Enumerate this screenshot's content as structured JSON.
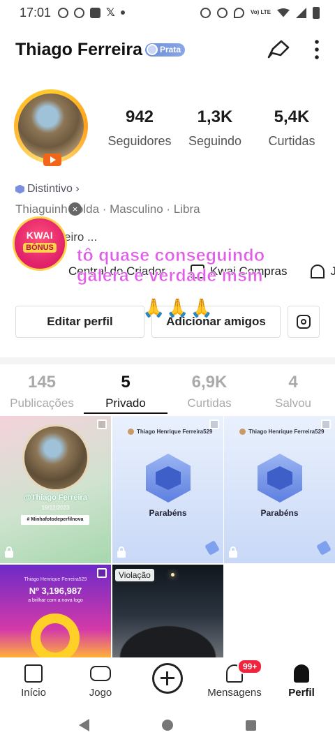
{
  "status_bar": {
    "time": "17:01",
    "network": "Vo) LTE"
  },
  "profile": {
    "name": "Thiago Ferreira",
    "level_badge": "Prata",
    "stats": [
      {
        "value": "942",
        "label": "Seguidores"
      },
      {
        "value": "1,3K",
        "label": "Seguindo"
      },
      {
        "value": "5,4K",
        "label": "Curtidas"
      }
    ],
    "distintivo": "Distintivo ›",
    "info_line": "Thiaguinh  solda · Masculino · Libra",
    "bio": "eiro ..."
  },
  "kwai_bonus": {
    "line1": "KWAI",
    "line2": "BÔNUS"
  },
  "shortcuts": [
    "Central do Criador",
    "Kwai Compras",
    "Ju"
  ],
  "overlay_caption": {
    "line1": "tô quase conseguindo",
    "line2": "galera e verdade msm",
    "emoji": "🙏🙏🙏"
  },
  "buttons": {
    "edit": "Editar perfil",
    "add_friends": "Adicionar amigos"
  },
  "tabs": [
    {
      "value": "145",
      "label": "Publicações",
      "active": false
    },
    {
      "value": "5",
      "label": "Privado",
      "active": true
    },
    {
      "value": "6,9K",
      "label": "Curtidas",
      "active": false
    },
    {
      "value": "4",
      "label": "Salvou",
      "active": false
    }
  ],
  "grid": {
    "post1": {
      "name": "@Thiago Ferreira",
      "date": "19/12/2023",
      "tag": "# Minhafotodeperfilnova"
    },
    "post2": {
      "header": "Thiago Henrique Ferreira529",
      "title": "Parabéns"
    },
    "post3": {
      "header": "Thiago Henrique Ferreira529",
      "title": "Parabéns"
    },
    "post4": {
      "header": "Thiago Henrique Ferreira529",
      "number": "Nº 3,196,987",
      "sub": "a brilhar com a nova logo"
    },
    "post5": {
      "label": "Violação"
    }
  },
  "bottom_nav": [
    {
      "label": "Início",
      "icon": "home-icon"
    },
    {
      "label": "Jogo",
      "icon": "gamepad-icon"
    },
    {
      "label": "",
      "icon": "plus-icon"
    },
    {
      "label": "Mensagens",
      "icon": "bell-icon",
      "badge": "99+"
    },
    {
      "label": "Perfil",
      "icon": "person-icon",
      "active": true
    }
  ],
  "colors": {
    "overlay": "#e15ce9",
    "badge_red": "#f0243c",
    "prata_blue": "#7b96e4"
  }
}
